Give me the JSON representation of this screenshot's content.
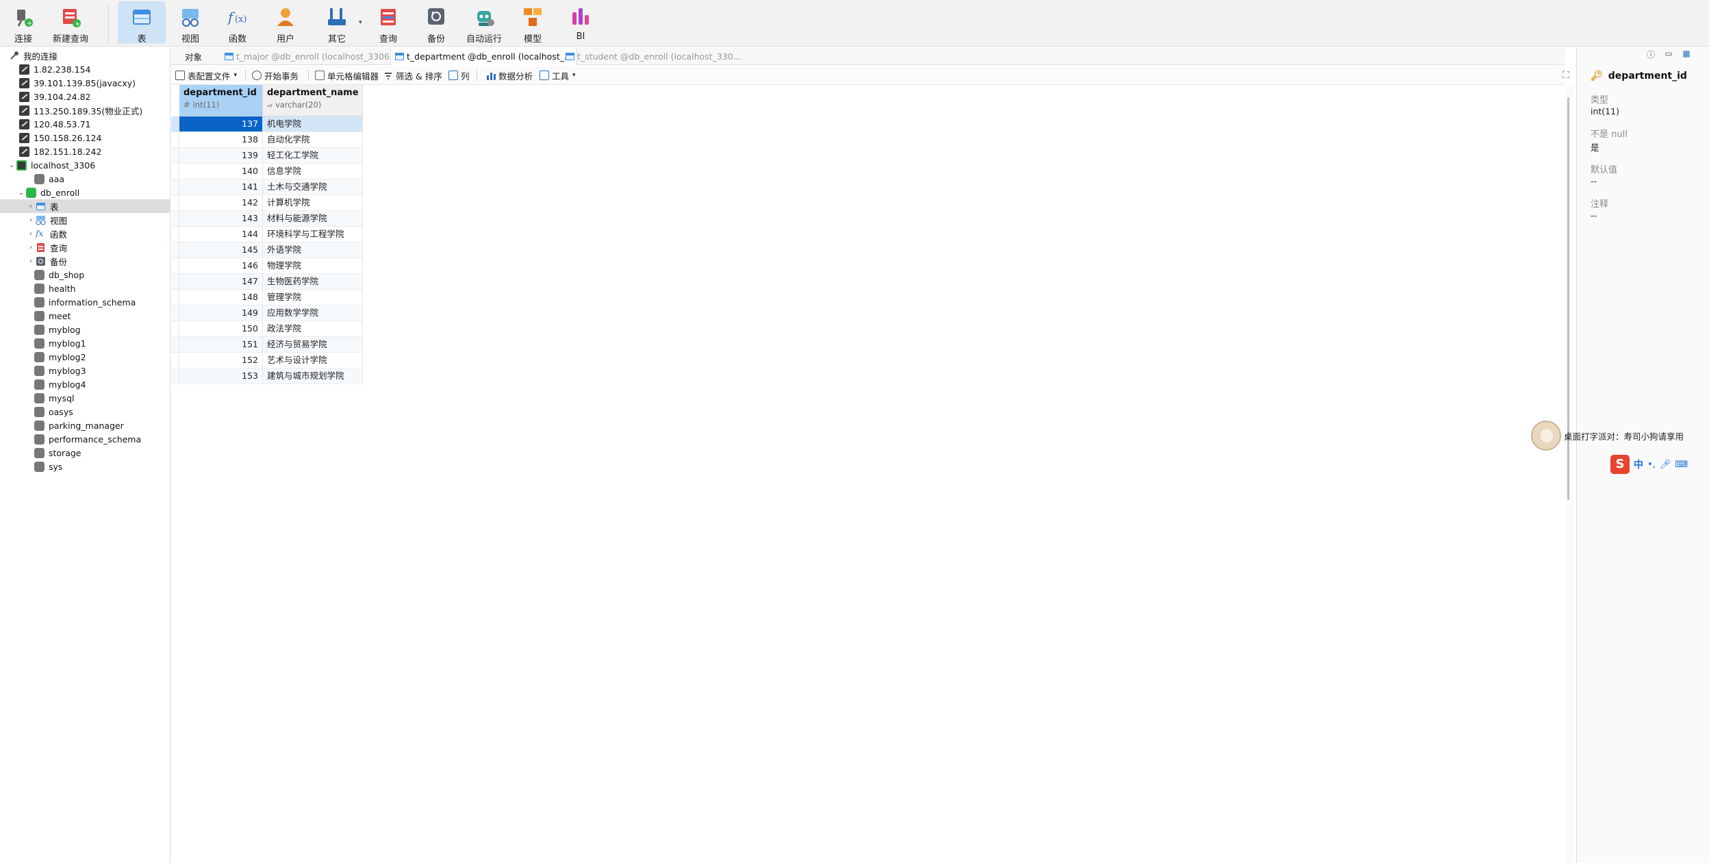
{
  "toolbar": {
    "items": [
      {
        "key": "connect",
        "label": "连接",
        "icon": "plug-icon"
      },
      {
        "key": "new_query",
        "label": "新建查询",
        "icon": "new-query-icon"
      },
      {
        "key": "table",
        "label": "表",
        "icon": "table-icon",
        "active": true
      },
      {
        "key": "view",
        "label": "视图",
        "icon": "view-icon"
      },
      {
        "key": "function",
        "label": "函数",
        "icon": "function-icon"
      },
      {
        "key": "user",
        "label": "用户",
        "icon": "user-icon"
      },
      {
        "key": "other",
        "label": "其它",
        "icon": "tools-icon"
      },
      {
        "key": "query",
        "label": "查询",
        "icon": "query-icon"
      },
      {
        "key": "backup",
        "label": "备份",
        "icon": "backup-icon"
      },
      {
        "key": "automation",
        "label": "自动运行",
        "icon": "robot-icon"
      },
      {
        "key": "model",
        "label": "模型",
        "icon": "model-icon"
      },
      {
        "key": "bi",
        "label": "BI",
        "icon": "bi-icon"
      }
    ]
  },
  "sidebar": {
    "root_label": "我的连接",
    "connections": [
      "1.82.238.154",
      "39.101.139.85(javacxy)",
      "39.104.24.82",
      "113.250.189.35(物业正式)",
      "120.48.53.71",
      "150.158.26.124",
      "182.151.18.242",
      "localhost_3306"
    ],
    "databases_before": [
      "aaa",
      "db_enroll"
    ],
    "db_enroll_children": [
      "表",
      "视图",
      "函数",
      "查询",
      "备份"
    ],
    "databases_after": [
      "db_shop",
      "health",
      "information_schema",
      "meet",
      "myblog",
      "myblog1",
      "myblog2",
      "myblog3",
      "myblog4",
      "mysql",
      "oasys",
      "parking_manager",
      "performance_schema",
      "storage",
      "sys"
    ]
  },
  "tabs": {
    "objects": "对象",
    "items": [
      {
        "label": "t_major @db_enroll (localhost_3306)...",
        "current": false
      },
      {
        "label": "t_department @db_enroll (localhost_...",
        "current": true
      },
      {
        "label": "t_student @db_enroll (localhost_330...",
        "current": false
      }
    ]
  },
  "subtoolbar": {
    "profile": "表配置文件",
    "begin_transaction": "开始事务",
    "cell_editor": "单元格编辑器",
    "filter_sort": "筛选 & 排序",
    "columns": "列",
    "data_analysis": "数据分析",
    "tools": "工具"
  },
  "grid": {
    "columns": [
      {
        "name": "department_id",
        "type": "int(11)"
      },
      {
        "name": "department_name",
        "type": "varchar(20)"
      }
    ],
    "rows": [
      {
        "id": "137",
        "name": "机电学院"
      },
      {
        "id": "138",
        "name": "自动化学院"
      },
      {
        "id": "139",
        "name": "轻工化工学院"
      },
      {
        "id": "140",
        "name": "信息学院"
      },
      {
        "id": "141",
        "name": "土木与交通学院"
      },
      {
        "id": "142",
        "name": "计算机学院"
      },
      {
        "id": "143",
        "name": "材料与能源学院"
      },
      {
        "id": "144",
        "name": "环境科学与工程学院"
      },
      {
        "id": "145",
        "name": "外语学院"
      },
      {
        "id": "146",
        "name": "物理学院"
      },
      {
        "id": "147",
        "name": "生物医药学院"
      },
      {
        "id": "148",
        "name": "管理学院"
      },
      {
        "id": "149",
        "name": "应用数学学院"
      },
      {
        "id": "150",
        "name": "政法学院"
      },
      {
        "id": "151",
        "name": "经济与贸易学院"
      },
      {
        "id": "152",
        "name": "艺术与设计学院"
      },
      {
        "id": "153",
        "name": "建筑与城市规划学院"
      }
    ]
  },
  "right_panel": {
    "field": "department_id",
    "type_label": "类型",
    "type_value": "int(11)",
    "not_null_label": "不是 null",
    "not_null_value": "是",
    "default_label": "默认值",
    "default_value": "--",
    "comment_label": "注释",
    "comment_value": "--"
  },
  "notification": {
    "text": "桌面打字派对：寿司小狗请享用"
  },
  "ime": {
    "mode": "中"
  }
}
